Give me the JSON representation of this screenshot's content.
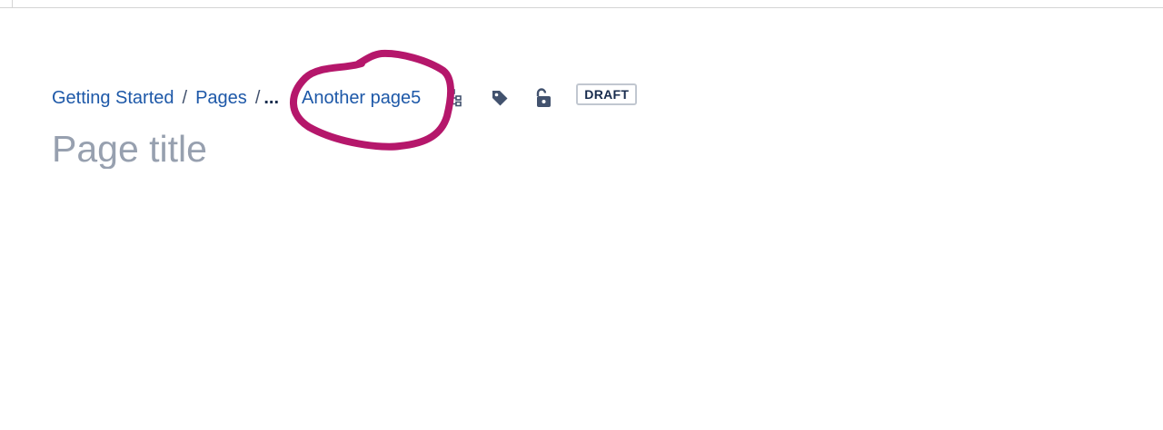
{
  "breadcrumb": {
    "items": [
      {
        "label": "Getting Started"
      },
      {
        "label": "Pages"
      }
    ],
    "separator": "/",
    "ellipsis": "...",
    "current": "Another page5"
  },
  "toolbar": {
    "icons": [
      "page-tree-icon",
      "label-icon",
      "unlock-icon"
    ],
    "status_badge": "DRAFT"
  },
  "page_title_placeholder": "Page title",
  "colors": {
    "link": "#1d58a8",
    "icon": "#42526e",
    "placeholder": "#97a0af",
    "annotation": "#b5176b"
  }
}
